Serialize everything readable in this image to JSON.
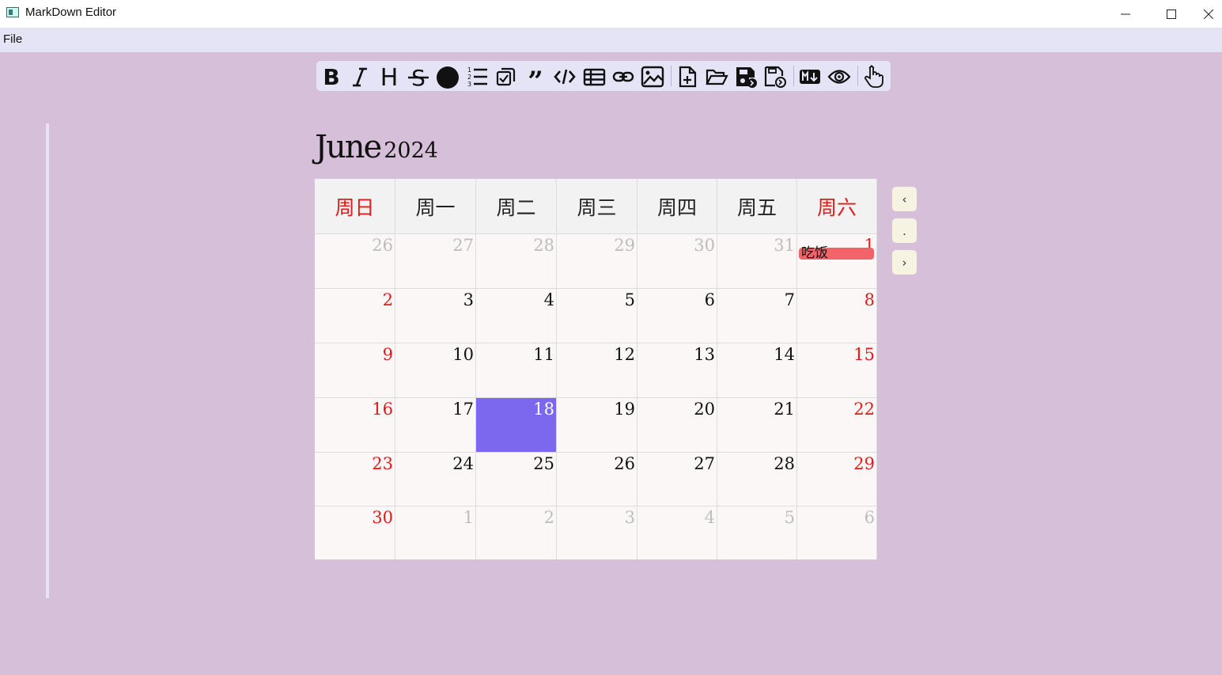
{
  "window": {
    "title": "MarkDown Editor",
    "minimize": "—",
    "maximize": "☐",
    "close": "✕"
  },
  "menu": {
    "file": "File"
  },
  "calendar": {
    "month": "June",
    "year": "2024",
    "weekdays": [
      "周日",
      "周一",
      "周二",
      "周三",
      "周四",
      "周五",
      "周六"
    ],
    "weeks": [
      [
        {
          "d": "26",
          "other": true
        },
        {
          "d": "27",
          "other": true
        },
        {
          "d": "28",
          "other": true
        },
        {
          "d": "29",
          "other": true
        },
        {
          "d": "30",
          "other": true
        },
        {
          "d": "31",
          "other": true
        },
        {
          "d": "1",
          "event": "吃饭"
        }
      ],
      [
        {
          "d": "2"
        },
        {
          "d": "3"
        },
        {
          "d": "4"
        },
        {
          "d": "5"
        },
        {
          "d": "6"
        },
        {
          "d": "7"
        },
        {
          "d": "8"
        }
      ],
      [
        {
          "d": "9"
        },
        {
          "d": "10"
        },
        {
          "d": "11"
        },
        {
          "d": "12"
        },
        {
          "d": "13"
        },
        {
          "d": "14"
        },
        {
          "d": "15"
        }
      ],
      [
        {
          "d": "16"
        },
        {
          "d": "17"
        },
        {
          "d": "18",
          "today": true
        },
        {
          "d": "19"
        },
        {
          "d": "20"
        },
        {
          "d": "21"
        },
        {
          "d": "22"
        }
      ],
      [
        {
          "d": "23"
        },
        {
          "d": "24"
        },
        {
          "d": "25"
        },
        {
          "d": "26"
        },
        {
          "d": "27"
        },
        {
          "d": "28"
        },
        {
          "d": "29"
        }
      ],
      [
        {
          "d": "30"
        },
        {
          "d": "1",
          "other": true
        },
        {
          "d": "2",
          "other": true
        },
        {
          "d": "3",
          "other": true
        },
        {
          "d": "4",
          "other": true
        },
        {
          "d": "5",
          "other": true
        },
        {
          "d": "6",
          "other": true
        }
      ]
    ],
    "nav": {
      "prev": "‹",
      "today": ".",
      "next": "›"
    },
    "colors": {
      "weekend": "#e21a1a",
      "today_bg": "#7b68ee",
      "event_bg": "#f0646a",
      "other_month": "#bdbdbd"
    }
  },
  "toolbar": {
    "buttons": [
      "bold-icon",
      "italic-icon",
      "heading-icon",
      "strikethrough-icon",
      "color-dot-icon",
      "ordered-list-icon",
      "task-list-icon",
      "quote-icon",
      "code-icon",
      "table-icon",
      "link-icon",
      "image-icon",
      "new-file-icon",
      "open-folder-icon",
      "save-icon",
      "save-as-icon",
      "markdown-icon",
      "preview-icon",
      "pointer-hand-icon"
    ]
  }
}
